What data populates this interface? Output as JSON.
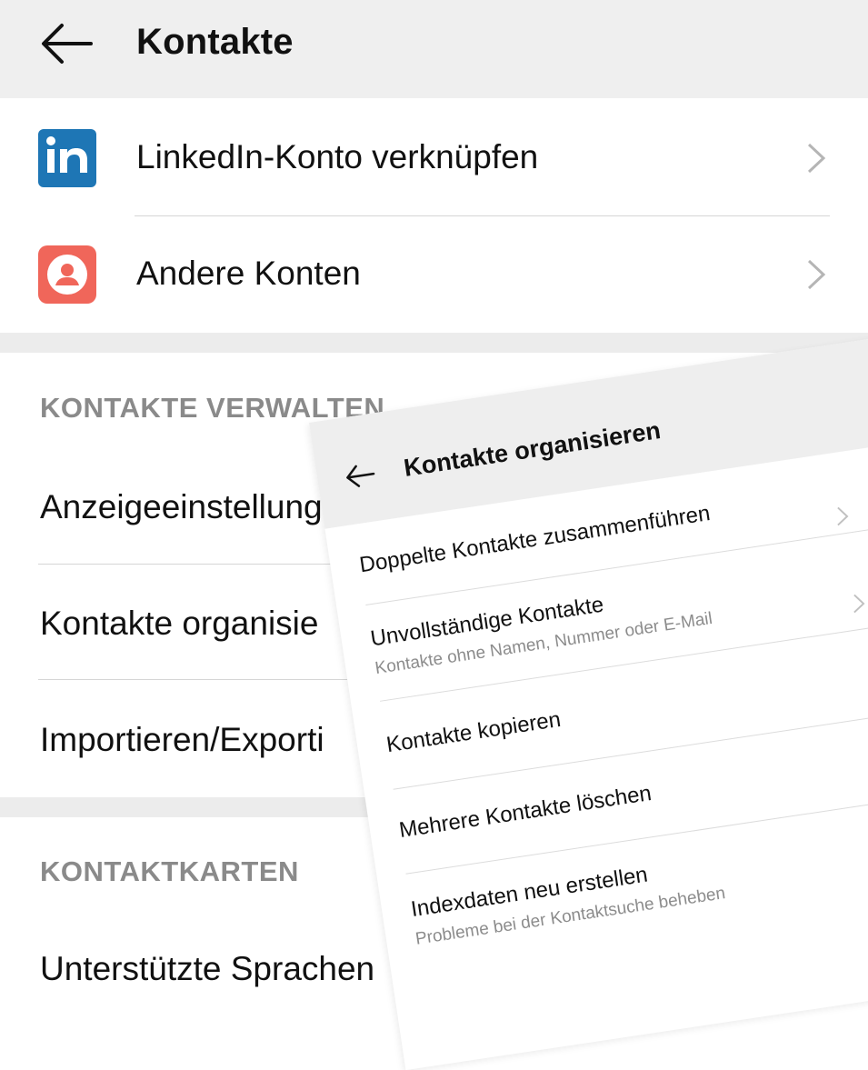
{
  "header": {
    "title": "Kontakte"
  },
  "accounts": [
    {
      "label": "LinkedIn-Konto verknüpfen",
      "icon": "linkedin-icon",
      "icon_color": "#1e76b5"
    },
    {
      "label": "Andere Konten",
      "icon": "account-icon",
      "icon_color": "#f0665a"
    }
  ],
  "manage": {
    "header": "KONTAKTE VERWALTEN",
    "items": [
      "Anzeigeeinstellungen",
      "Kontakte organisie",
      "Importieren/Exporti"
    ]
  },
  "cards": {
    "header": "KONTAKTKARTEN",
    "items": [
      "Unterstützte Sprachen"
    ]
  },
  "overlay": {
    "title": "Kontakte organisieren",
    "items": [
      {
        "label": "Doppelte Kontakte zusammenführen",
        "sub": ""
      },
      {
        "label": "Unvollständige Kontakte",
        "sub": "Kontakte ohne Namen, Nummer oder E-Mail"
      },
      {
        "label": "Kontakte kopieren",
        "sub": ""
      },
      {
        "label": "Mehrere Kontakte löschen",
        "sub": ""
      },
      {
        "label": "Indexdaten neu erstellen",
        "sub": "Probleme bei der Kontaktsuche beheben"
      }
    ]
  }
}
